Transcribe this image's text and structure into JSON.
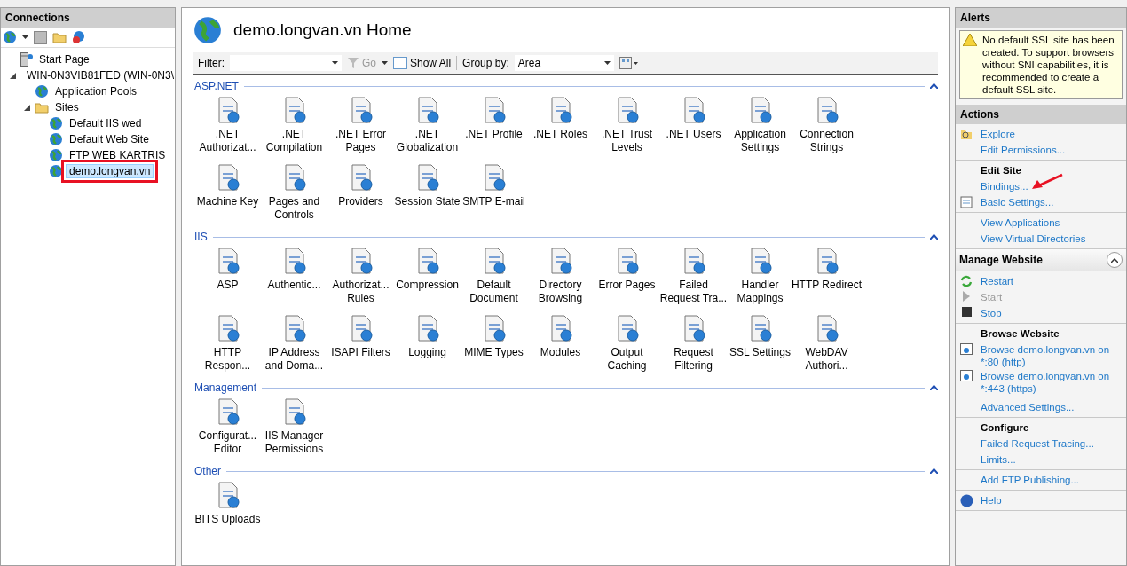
{
  "connections": {
    "title": "Connections",
    "tree": [
      {
        "label": "Start Page",
        "selected": false
      },
      {
        "label": "WIN-0N3VIB81FED (WIN-0N3\\",
        "selected": false,
        "expanded": true,
        "children": [
          {
            "label": "Application Pools",
            "selected": false
          },
          {
            "label": "Sites",
            "selected": false,
            "expanded": true,
            "children": [
              {
                "label": "Default IIS wed",
                "selected": false
              },
              {
                "label": "Default Web Site",
                "selected": false
              },
              {
                "label": "FTP WEB KARTRIS",
                "selected": false
              },
              {
                "label": "demo.longvan.vn",
                "selected": true
              }
            ]
          }
        ]
      }
    ]
  },
  "home": {
    "title": "demo.longvan.vn Home",
    "toolbar": {
      "filter_label": "Filter:",
      "go": "Go",
      "show_all": "Show All",
      "group_by_label": "Group by:",
      "group_by_value": "Area"
    },
    "sections": [
      {
        "title": "ASP.NET",
        "features": [
          ".NET Authorizat...",
          ".NET Compilation",
          ".NET Error Pages",
          ".NET Globalization",
          ".NET Profile",
          ".NET Roles",
          ".NET Trust Levels",
          ".NET Users",
          "Application Settings",
          "Connection Strings",
          "Machine Key",
          "Pages and Controls",
          "Providers",
          "Session State",
          "SMTP E-mail"
        ]
      },
      {
        "title": "IIS",
        "features": [
          "ASP",
          "Authentic...",
          "Authorizat... Rules",
          "Compression",
          "Default Document",
          "Directory Browsing",
          "Error Pages",
          "Failed Request Tra...",
          "Handler Mappings",
          "HTTP Redirect",
          "HTTP Respon...",
          "IP Address and Doma...",
          "ISAPI Filters",
          "Logging",
          "MIME Types",
          "Modules",
          "Output Caching",
          "Request Filtering",
          "SSL Settings",
          "WebDAV Authori..."
        ]
      },
      {
        "title": "Management",
        "features": [
          "Configurat... Editor",
          "IIS Manager Permissions"
        ]
      },
      {
        "title": "Other",
        "features": [
          "BITS Uploads"
        ]
      }
    ]
  },
  "alerts": {
    "title": "Alerts",
    "message": "No default SSL site has been created. To support browsers without SNI capabilities, it is recommended to create a default SSL site."
  },
  "actions": {
    "title": "Actions",
    "groups": [
      {
        "items": [
          {
            "kind": "link",
            "label": "Explore"
          },
          {
            "kind": "link",
            "label": "Edit Permissions..."
          }
        ]
      },
      {
        "items": [
          {
            "kind": "heading",
            "label": "Edit Site"
          },
          {
            "kind": "link",
            "label": "Bindings..."
          },
          {
            "kind": "link",
            "label": "Basic Settings..."
          }
        ]
      },
      {
        "items": [
          {
            "kind": "link",
            "label": "View Applications"
          },
          {
            "kind": "link",
            "label": "View Virtual Directories"
          }
        ]
      }
    ],
    "manage": {
      "title": "Manage Website",
      "groups": [
        {
          "items": [
            {
              "kind": "link",
              "label": "Restart"
            },
            {
              "kind": "disabled",
              "label": "Start"
            },
            {
              "kind": "link",
              "label": "Stop"
            }
          ]
        },
        {
          "items": [
            {
              "kind": "heading",
              "label": "Browse Website"
            },
            {
              "kind": "link",
              "label": "Browse demo.longvan.vn on *:80 (http)"
            },
            {
              "kind": "link",
              "label": "Browse demo.longvan.vn on *:443 (https)"
            }
          ]
        },
        {
          "items": [
            {
              "kind": "link",
              "label": "Advanced Settings..."
            }
          ]
        },
        {
          "items": [
            {
              "kind": "heading",
              "label": "Configure"
            },
            {
              "kind": "link",
              "label": "Failed Request Tracing..."
            },
            {
              "kind": "link",
              "label": "Limits..."
            }
          ]
        },
        {
          "items": [
            {
              "kind": "link",
              "label": "Add FTP Publishing..."
            }
          ]
        },
        {
          "items": [
            {
              "kind": "link",
              "label": "Help"
            }
          ]
        }
      ]
    }
  }
}
